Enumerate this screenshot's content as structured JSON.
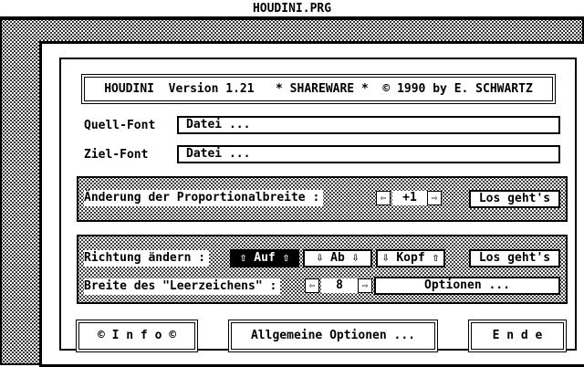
{
  "window_title": "HOUDINI.PRG",
  "header": {
    "text": "HOUDINI  Version 1.21   * SHAREWARE *  © 1990 by E. SCHWARTZ"
  },
  "quell": {
    "label": "Quell-Font",
    "value": "Datei ..."
  },
  "ziel": {
    "label": "Ziel-Font",
    "value": "Datei ..."
  },
  "prop": {
    "label": "Änderung der Proportionalbreite :",
    "left_arrow": "⇦",
    "value": "+1",
    "right_arrow": "⇨",
    "go": "Los geht's"
  },
  "richtung": {
    "label": "Richtung ändern :",
    "auf": "⇧ Auf ⇧",
    "ab": "⇩ Ab ⇩",
    "kopf": "⇩ Kopf ⇧",
    "go": "Los geht's"
  },
  "breite": {
    "label": "Breite des \"Leerzeichens\" :",
    "left_arrow": "⇦",
    "value": "8",
    "right_arrow": "⇨",
    "options": "Optionen ..."
  },
  "bottom": {
    "info": "© I n f o ©",
    "allgemein": "Allgemeine Optionen ...",
    "ende": "E n d e"
  }
}
